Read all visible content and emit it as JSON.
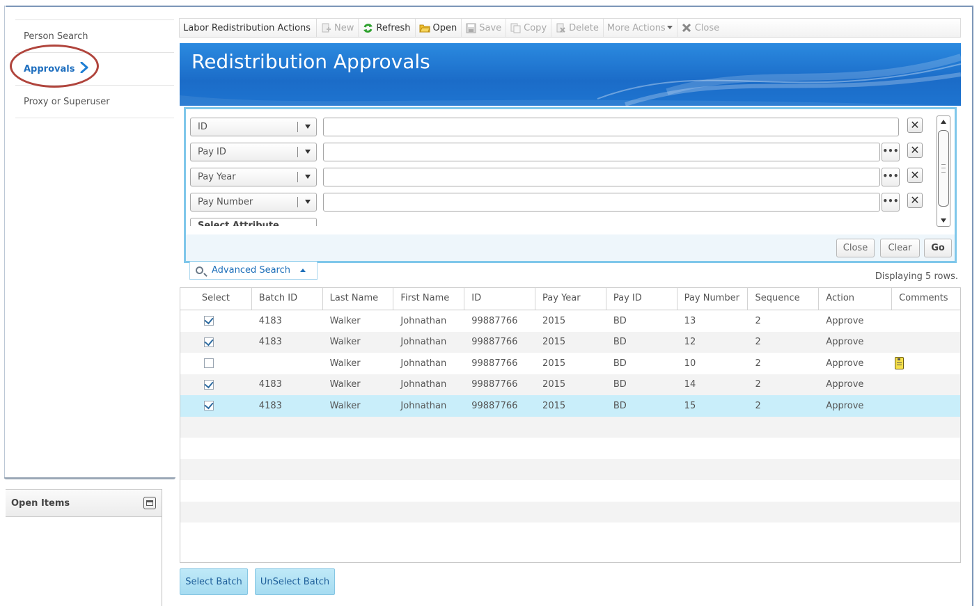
{
  "nav": {
    "items": [
      {
        "label": "Person Search"
      },
      {
        "label": "Approvals"
      },
      {
        "label": "Proxy or Superuser"
      }
    ]
  },
  "open_items": {
    "title": "Open Items"
  },
  "toolbar": {
    "label": "Labor Redistribution Actions",
    "buttons": [
      {
        "label": "New",
        "icon": "new-icon",
        "enabled": false
      },
      {
        "label": "Refresh",
        "icon": "refresh-icon",
        "enabled": true
      },
      {
        "label": "Open",
        "icon": "folder-icon",
        "enabled": true
      },
      {
        "label": "Save",
        "icon": "save-icon",
        "enabled": false
      },
      {
        "label": "Copy",
        "icon": "copy-icon",
        "enabled": false
      },
      {
        "label": "Delete",
        "icon": "delete-icon",
        "enabled": false
      },
      {
        "label": "More Actions",
        "icon": "chevron-down-icon",
        "enabled": false
      },
      {
        "label": "Close",
        "icon": "close-icon",
        "enabled": false
      }
    ]
  },
  "banner": {
    "title": "Redistribution Approvals"
  },
  "search": {
    "criteria": [
      {
        "attribute": "ID",
        "value": "",
        "has_lookup": false
      },
      {
        "attribute": "Pay ID",
        "value": "",
        "has_lookup": true
      },
      {
        "attribute": "Pay Year",
        "value": "",
        "has_lookup": true
      },
      {
        "attribute": "Pay Number",
        "value": "",
        "has_lookup": true
      }
    ],
    "next_attribute": "Select Attribute",
    "buttons": {
      "close": "Close",
      "clear": "Clear",
      "go": "Go"
    },
    "advanced_label": "Advanced Search",
    "lookup_glyph": "•••",
    "remove_glyph": "✕"
  },
  "grid": {
    "status": "Displaying 5 rows.",
    "columns": [
      "Select",
      "Batch ID",
      "Last Name",
      "First Name",
      "ID",
      "Pay Year",
      "Pay ID",
      "Pay Number",
      "Sequence",
      "Action",
      "Comments"
    ],
    "rows": [
      {
        "selected": true,
        "batch_id": "4183",
        "last_name": "Walker",
        "first_name": "Johnathan",
        "id": "99887766",
        "pay_year": "2015",
        "pay_id": "BD",
        "pay_number": "13",
        "sequence": "2",
        "action": "Approve",
        "has_comment": false
      },
      {
        "selected": true,
        "batch_id": "4183",
        "last_name": "Walker",
        "first_name": "Johnathan",
        "id": "99887766",
        "pay_year": "2015",
        "pay_id": "BD",
        "pay_number": "12",
        "sequence": "2",
        "action": "Approve",
        "has_comment": false
      },
      {
        "selected": false,
        "batch_id": "",
        "last_name": "Walker",
        "first_name": "Johnathan",
        "id": "99887766",
        "pay_year": "2015",
        "pay_id": "BD",
        "pay_number": "10",
        "sequence": "2",
        "action": "Approve",
        "has_comment": true
      },
      {
        "selected": true,
        "batch_id": "4183",
        "last_name": "Walker",
        "first_name": "Johnathan",
        "id": "99887766",
        "pay_year": "2015",
        "pay_id": "BD",
        "pay_number": "14",
        "sequence": "2",
        "action": "Approve",
        "has_comment": false
      },
      {
        "selected": true,
        "batch_id": "4183",
        "last_name": "Walker",
        "first_name": "Johnathan",
        "id": "99887766",
        "pay_year": "2015",
        "pay_id": "BD",
        "pay_number": "15",
        "sequence": "2",
        "action": "Approve",
        "has_comment": false
      }
    ]
  },
  "actions": {
    "select_batch": "Select Batch",
    "unselect_batch": "UnSelect Batch"
  },
  "colors": {
    "accent": "#1f6fbf",
    "banner": "#1b6cc8",
    "selected_row": "#c9eefa",
    "highlight_ring": "#b0443c"
  }
}
